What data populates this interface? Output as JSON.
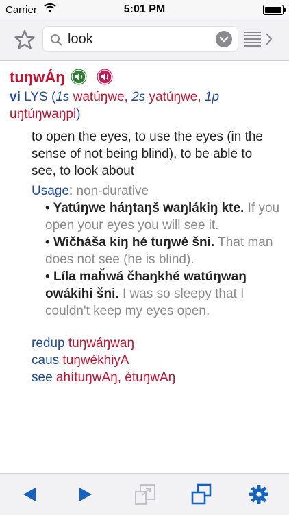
{
  "status_bar": {
    "carrier": "Carrier",
    "time": "5:01 PM"
  },
  "search": {
    "query": "look"
  },
  "entry": {
    "headword": "tuŋwÁŋ",
    "pos": "vi",
    "source": "LYS",
    "paren_open": "(",
    "paren_close": ")",
    "forms": [
      {
        "person": "1s",
        "form": "watúŋwe,"
      },
      {
        "person": "2s",
        "form": "yatúŋwe,"
      },
      {
        "person": "1p",
        "form": "uŋtúŋwaŋpi"
      }
    ],
    "definition": "to open the eyes, to use the eyes (in the sense of not being blind), to be able to see, to look about",
    "usage_label": "Usage:",
    "usage_value": "non-durative",
    "examples": [
      {
        "lakota": "Yatúŋwe háŋtaŋš waŋlákiŋ kte.",
        "english": "If you open your eyes you will see it."
      },
      {
        "lakota": "Wičháša kiŋ hé tuŋwé šni.",
        "english": "That man does not see (he is blind)."
      },
      {
        "lakota": "Líla maȟwá čhaŋkhé watúŋwaŋ owákihi šni.",
        "english": "I was so sleepy that I couldn't keep my eyes open."
      }
    ],
    "crossrefs": [
      {
        "label": "redup",
        "value": "tuŋwáŋwaŋ"
      },
      {
        "label": "caus",
        "value": "tuŋwékhiyA"
      },
      {
        "label": "see",
        "value": "ahítuŋwAŋ, étuŋwAŋ"
      }
    ]
  },
  "icons": {
    "star": "star-icon",
    "search": "search-icon",
    "dropdown": "chevron-down-icon",
    "list": "list-icon",
    "audio_male": "speaker-icon",
    "audio_female": "speaker-icon",
    "back": "arrow-left-icon",
    "forward": "arrow-right-icon",
    "compare": "resize-icon",
    "windows": "windows-icon",
    "settings": "gear-icon"
  },
  "colors": {
    "headword": "#c8102e",
    "label": "#1f4aa0",
    "gray": "#8a8a8a",
    "audio_male": "#2e7d32",
    "audio_female": "#c2185b",
    "toolbar_icon": "#1565c0"
  }
}
